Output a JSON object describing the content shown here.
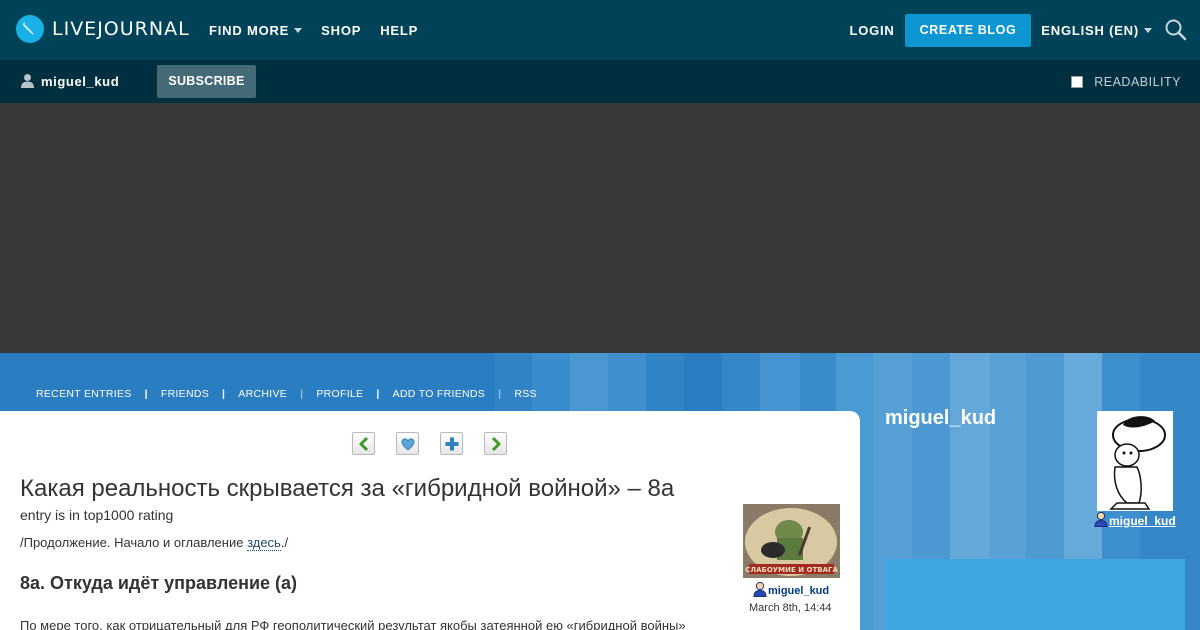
{
  "header": {
    "logo_text": "LIVEJOURNAL",
    "nav": [
      {
        "label": "FIND MORE",
        "has_caret": true
      },
      {
        "label": "SHOP",
        "has_caret": false
      },
      {
        "label": "HELP",
        "has_caret": false
      }
    ],
    "login_label": "LOGIN",
    "create_blog_label": "CREATE BLOG",
    "language_label": "ENGLISH (EN)",
    "colors": {
      "background": "#004359",
      "create_blog": "#0e96d2"
    }
  },
  "subbar": {
    "username": "miguel_kud",
    "subscribe_label": "SUBSCRIBE",
    "readability_label": "READABILITY",
    "readability_checked": false
  },
  "journal_nav": [
    {
      "label": "RECENT ENTRIES"
    },
    {
      "label": "FRIENDS"
    },
    {
      "label": "ARCHIVE"
    },
    {
      "label": "PROFILE"
    },
    {
      "label": "ADD TO FRIENDS"
    },
    {
      "label": "RSS"
    }
  ],
  "entry": {
    "title": "Какая реальность скрывается за «гибридной войной» – 8а",
    "rating_text": "entry is in top1000 rating",
    "continuation_prefix": "/Продолжение. Начало и оглавление ",
    "continuation_link": "здесь",
    "continuation_suffix": "./",
    "subheading": "8а. Откуда идёт управление (а)",
    "body_first_line": "По мере того, как отрицательный для РФ геополитический результат якобы затеянной ею «гибридной войны»",
    "author": "miguel_kud",
    "date": "March 8th, 14:44",
    "userpic_caption": "СЛАБОУМИЕ И ОТВАГА"
  },
  "sidebar": {
    "journal_name": "miguel_kud",
    "username": "miguel_kud"
  },
  "icons": {
    "arrow_buttons": [
      "prev-arrow-icon",
      "heart-icon",
      "add-icon",
      "next-arrow-icon"
    ]
  }
}
